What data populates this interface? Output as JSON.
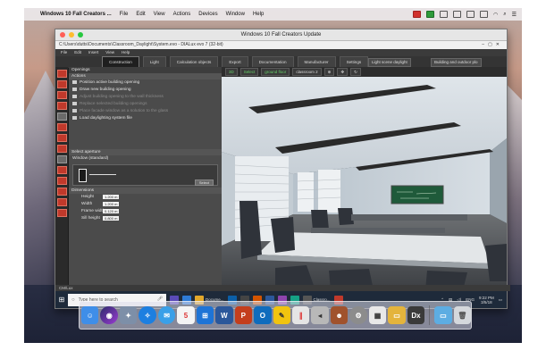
{
  "mac_menubar": {
    "app_name": "Windows 10 Fall Creators ...",
    "items": [
      "File",
      "Edit",
      "View",
      "Actions",
      "Devices",
      "Window",
      "Help"
    ]
  },
  "vm_window": {
    "title": "Windows 10 Fall Creators Update",
    "path": "C:\\Users\\dutts\\Documents\\Classroom_Daylight\\System.evo - DIALux evo 7 (32-bit)",
    "menu": [
      "File",
      "Edit",
      "Insert",
      "View",
      "Help"
    ],
    "ribbon_tabs": [
      "Construction",
      "Light",
      "Calculation objects",
      "Export",
      "Documentation",
      "Manufacturer",
      "Settings"
    ],
    "ribbon_selects": [
      "Light scene daylight",
      "Building and outdoor plo"
    ]
  },
  "left_panel": {
    "sections": {
      "openings": "Openings",
      "actions": "Actions",
      "select_aperture": "Select aperture",
      "dimensions": "Dimensions"
    },
    "actions": [
      {
        "label": "Position active building opening",
        "disabled": false
      },
      {
        "label": "Draw new building opening",
        "disabled": false
      },
      {
        "label": "Adjust building opening to the wall thickness",
        "disabled": true
      },
      {
        "label": "Replace selected building openings",
        "disabled": true
      },
      {
        "label": "Place facade window as a solution to the glass",
        "disabled": true
      },
      {
        "label": "Load daylighting system file",
        "disabled": false
      }
    ],
    "aperture_label": "Window (standard)",
    "select_button": "Select",
    "dimensions": [
      {
        "label": "Height",
        "value": "1.200 m"
      },
      {
        "label": "Width",
        "value": "1.200 m"
      },
      {
        "label": "Frame width",
        "value": "0.120 m"
      },
      {
        "label": "Sill height",
        "value": "0.800 m"
      }
    ]
  },
  "viewport": {
    "toolbar": [
      "3D",
      "Select",
      "ground floor",
      "classroom 2"
    ]
  },
  "statusbar": "CM/Lux",
  "taskbar": {
    "search_placeholder": "Type here to search",
    "document_label": "Docume...",
    "app_label": "Classro...",
    "lang": "ENG",
    "time": "9:22 PM",
    "date": "3/5/18"
  },
  "dock_apps": [
    "Finder",
    "Siri",
    "Launchpad",
    "Safari",
    "Mail",
    "Calendar",
    "Windows",
    "Word",
    "PowerPoint",
    "Outlook",
    "Notes",
    "Parallels",
    "Contacts",
    "Photos",
    "Settings",
    "Preview",
    "Folder",
    "DIALux",
    "Files",
    "Trash"
  ]
}
